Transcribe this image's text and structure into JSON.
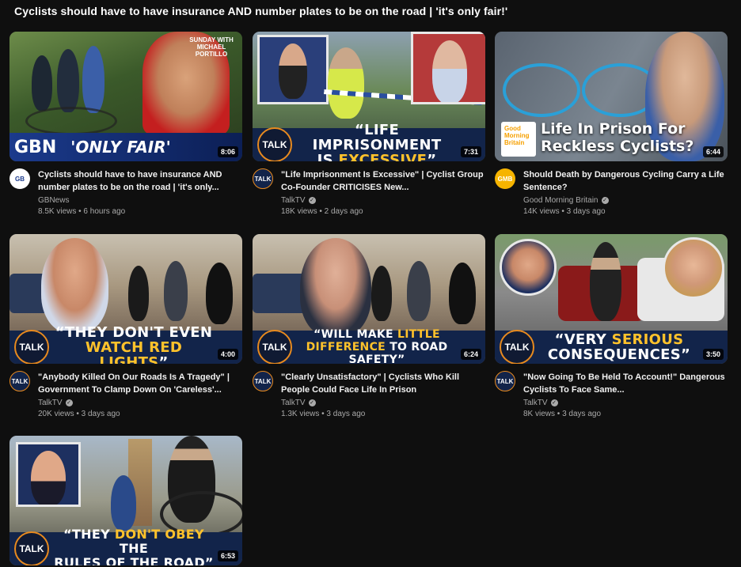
{
  "page": {
    "title": "Cyclists should have to have insurance AND number plates to be on the road | 'it's only fair!'"
  },
  "videos": [
    {
      "title": "Cyclists should have to have insurance AND number plates to be on the road | 'it's only...",
      "channel": "GBNews",
      "verified": false,
      "views": "8.5K views",
      "age": "6 hours ago",
      "duration": "8:06",
      "avatar": "GB",
      "thumb_brand": "GBN",
      "thumb_text_plain": "'ONLY FAIR'",
      "thumb_sub": "SUNDAY WITH MICHAEL PORTILLO"
    },
    {
      "title": "\"Life Imprisonment Is Excessive\" | Cyclist Group Co-Founder CRITICISES New...",
      "channel": "TalkTV",
      "verified": true,
      "views": "18K views",
      "age": "2 days ago",
      "duration": "7:31",
      "avatar": "TALK",
      "thumb_line1": "“LIFE IMPRISONMENT",
      "thumb_line2_plain": "IS ",
      "thumb_line2_hl": "EXCESSIVE",
      "thumb_line2_end": "”"
    },
    {
      "title": "Should Death by Dangerous Cycling Carry a Life Sentence?",
      "channel": "Good Morning Britain",
      "verified": true,
      "views": "14K views",
      "age": "3 days ago",
      "duration": "6:44",
      "avatar": "GMB",
      "thumb_brand": "Good Morning Britain",
      "thumb_text": "Life In Prison For Reckless Cyclists?"
    },
    {
      "title": "\"Anybody Killed On Our Roads Is A Tragedy\" | Government To Clamp Down On 'Careless'...",
      "channel": "TalkTV",
      "verified": true,
      "views": "20K views",
      "age": "3 days ago",
      "duration": "4:00",
      "avatar": "TALK",
      "thumb_line1": "“THEY DON'T EVEN",
      "thumb_line2_hl": "WATCH RED LIGHTS",
      "thumb_line2_end": "”"
    },
    {
      "title": "\"Clearly Unsatisfactory\" | Cyclists Who Kill People Could Face Life In Prison",
      "channel": "TalkTV",
      "verified": true,
      "views": "1.3K views",
      "age": "3 days ago",
      "duration": "6:24",
      "avatar": "TALK",
      "thumb_line1_a": "“WILL MAKE ",
      "thumb_line1_hl": "LITTLE",
      "thumb_line2_hl": "DIFFERENCE",
      "thumb_line2_end": " TO ROAD SAFETY”"
    },
    {
      "title": "\"Now Going To Be Held To Account!\" Dangerous Cyclists To Face Same...",
      "channel": "TalkTV",
      "verified": true,
      "views": "8K views",
      "age": "3 days ago",
      "duration": "3:50",
      "avatar": "TALK",
      "thumb_line1_a": "“VERY ",
      "thumb_line1_hl": "SERIOUS",
      "thumb_line2": "CONSEQUENCES”"
    },
    {
      "title": "",
      "channel": "",
      "duration": "6:53",
      "avatar": "TALK",
      "thumb_line1_a": "“THEY ",
      "thumb_line1_hl": "DON'T OBEY",
      "thumb_line1_end": " THE",
      "thumb_line2": "RULES OF THE ROAD”"
    }
  ],
  "brand": {
    "talk_logo": "TALK"
  },
  "colors": {
    "background": "#0f0f0f",
    "accent": "#ffc22b",
    "talk_ring": "#e88a1e"
  },
  "icons": {
    "verified": "verified-check-icon"
  }
}
